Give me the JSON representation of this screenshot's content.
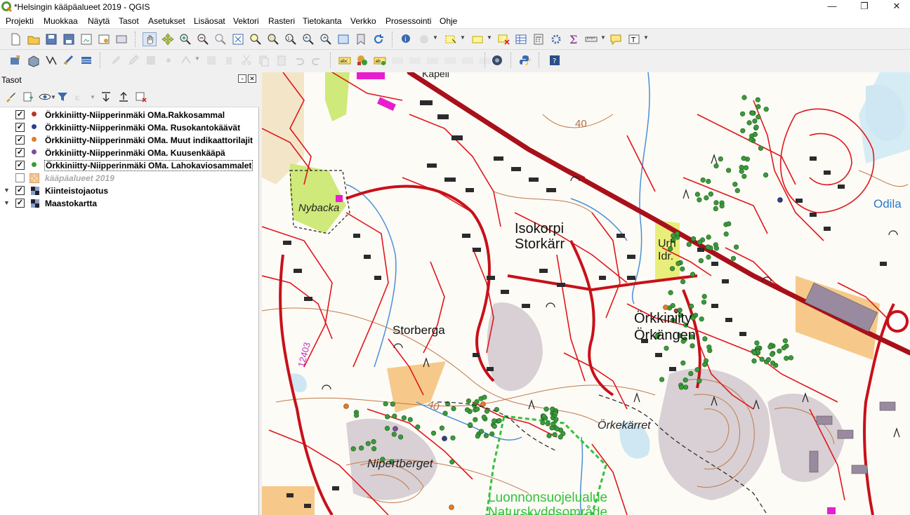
{
  "window": {
    "title": "*Helsingin kääpäalueet 2019 - QGIS",
    "minimize": "—",
    "maximize": "❐",
    "close": "✕"
  },
  "menu": [
    "Projekti",
    "Muokkaa",
    "Näytä",
    "Tasot",
    "Asetukset",
    "Lisäosat",
    "Vektori",
    "Rasteri",
    "Tietokanta",
    "Verkko",
    "Prosessointi",
    "Ohje"
  ],
  "layers_panel": {
    "title": "Tasot",
    "layers": [
      {
        "name": "Örkkiniitty-Niipperinmäki OMa.Rakkosammal",
        "checked": true,
        "color": "#b2392c",
        "style": "normal"
      },
      {
        "name": "Örkkiniitty-Niipperinmäki OMa. Rusokantokäävät",
        "checked": true,
        "color": "#2e3f8f",
        "style": "normal"
      },
      {
        "name": "Örkkiniitty-Niipperinmäki OMa. Muut indikaattorilajit",
        "checked": true,
        "color": "#e07b2a",
        "style": "normal"
      },
      {
        "name": "Örkkiniitty-Niipperinmäki OMa. Kuusenkääpä",
        "checked": true,
        "color": "#7d4e9a",
        "style": "normal"
      },
      {
        "name": "Örkkiniitty-Niipperinmäki OMa. Lahokaviosammalet",
        "checked": true,
        "color": "#3a9a3a",
        "style": "normal"
      },
      {
        "name": "kääpäalueet 2019",
        "checked": false,
        "color": "#f0b070",
        "style": "grey"
      },
      {
        "name": "Kiinteistojaotus",
        "checked": true,
        "color": "",
        "style": "group"
      },
      {
        "name": "Maastokartta",
        "checked": true,
        "color": "",
        "style": "group"
      }
    ]
  },
  "map": {
    "labels": {
      "isokorpi": "Isokorpi",
      "storkarr": "Storkärr",
      "nybacka": "Nybacka",
      "storberga": "Storberga",
      "orkkiniitty": "Örkkiniity",
      "orkangen": "Örkängen",
      "orkekarret": "Örkekärret",
      "nipertberget": "Nipertberget",
      "luonnonsuojelualue": "Luonnonsuojelualue",
      "naturskyddsomrade": "Naturskyddsområde",
      "odila": "Odila",
      "urh": "Urh",
      "idr": "Idr.",
      "contour40a": "40",
      "contour40b": "40",
      "road": "12403",
      "kapell": "Kapell"
    }
  }
}
